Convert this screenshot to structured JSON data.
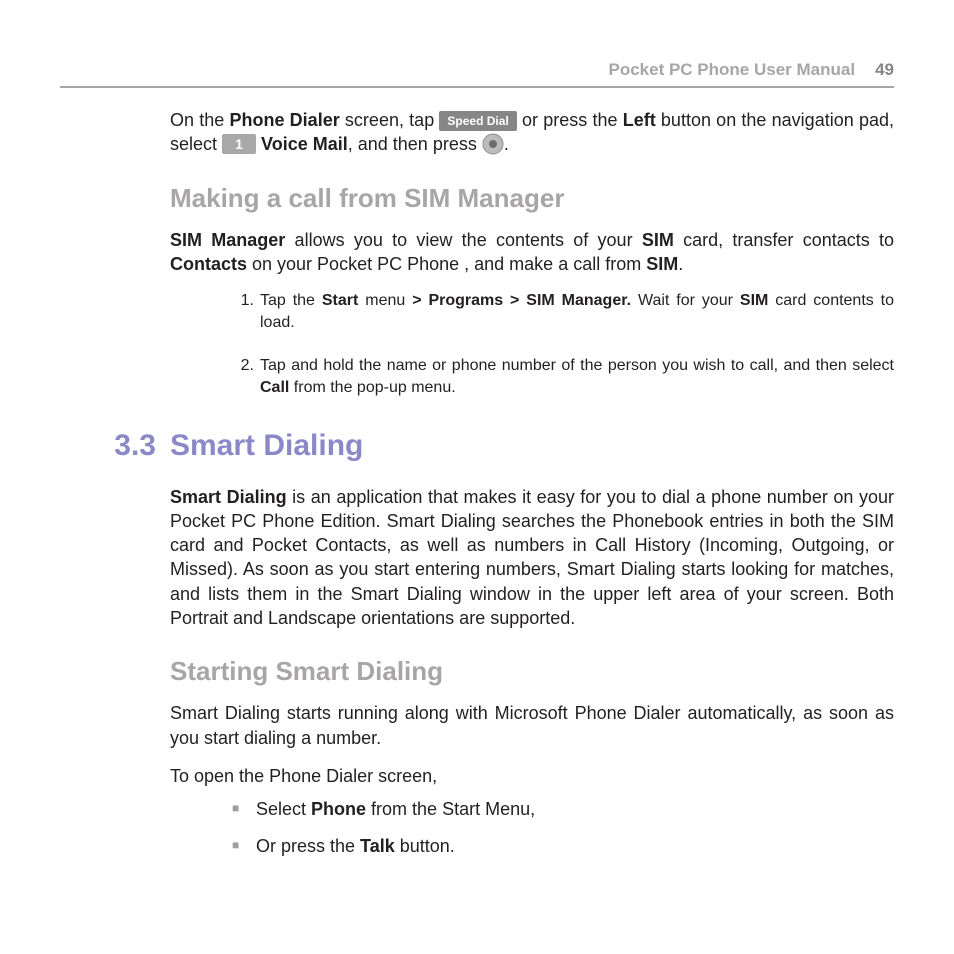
{
  "header": {
    "title": "Pocket PC Phone User Manual",
    "page_number": "49"
  },
  "intro": {
    "p1a": "On the ",
    "p1b": "Phone Dialer",
    "p1c": " screen, tap ",
    "btn_speed_dial": "Speed Dial",
    "p1d": " or press the ",
    "p1e": "Left",
    "p1f": " button on the navigation pad, select ",
    "btn_one": "1",
    "p1g": "Voice Mail",
    "p1h": ", and then press ",
    "p1i": "."
  },
  "sim": {
    "heading": "Making a call from SIM Manager",
    "p_a": "SIM Manager",
    "p_b": " allows you to view the contents of your ",
    "p_c": "SIM",
    "p_d": " card, transfer contacts to ",
    "p_e": "Contacts",
    "p_f": " on your Pocket PC Phone , and make a call from ",
    "p_g": "SIM",
    "p_h": ".",
    "steps": [
      {
        "n": "1.",
        "a": "Tap the ",
        "b": "Start",
        "c": " menu ",
        "d": "> Programs > SIM Manager.",
        "e": " Wait for your ",
        "f": "SIM",
        "g": " card contents to load."
      },
      {
        "n": "2.",
        "a": "Tap and hold the name or phone number of the person you wish to call, and then select ",
        "b": "Call",
        "c": " from the pop-up menu."
      }
    ]
  },
  "section": {
    "num": "3.3",
    "title": "Smart Dialing"
  },
  "smart": {
    "p1_a": "Smart Dialing",
    "p1_b": " is an application that makes it easy for you to dial a phone number on your Pocket PC Phone Edition.  Smart Dialing searches the Phonebook entries in both the SIM card and Pocket Contacts, as well as numbers in Call History (Incoming, Outgoing, or Missed).  As soon as you start entering numbers, Smart Dialing starts looking for matches, and lists them in the Smart Dialing window in the upper left area of your screen.  Both Portrait and Landscape orientations are supported."
  },
  "starting": {
    "heading": "Starting Smart Dialing",
    "p1": "Smart Dialing starts running along with Microsoft Phone Dialer automatically, as soon as you start dialing a number.",
    "p2": "To open the Phone Dialer screen,",
    "bul1_a": "Select ",
    "bul1_b": "Phone",
    "bul1_c": " from the Start Menu,",
    "bul2_a": "Or press the ",
    "bul2_b": "Talk",
    "bul2_c": " button."
  }
}
